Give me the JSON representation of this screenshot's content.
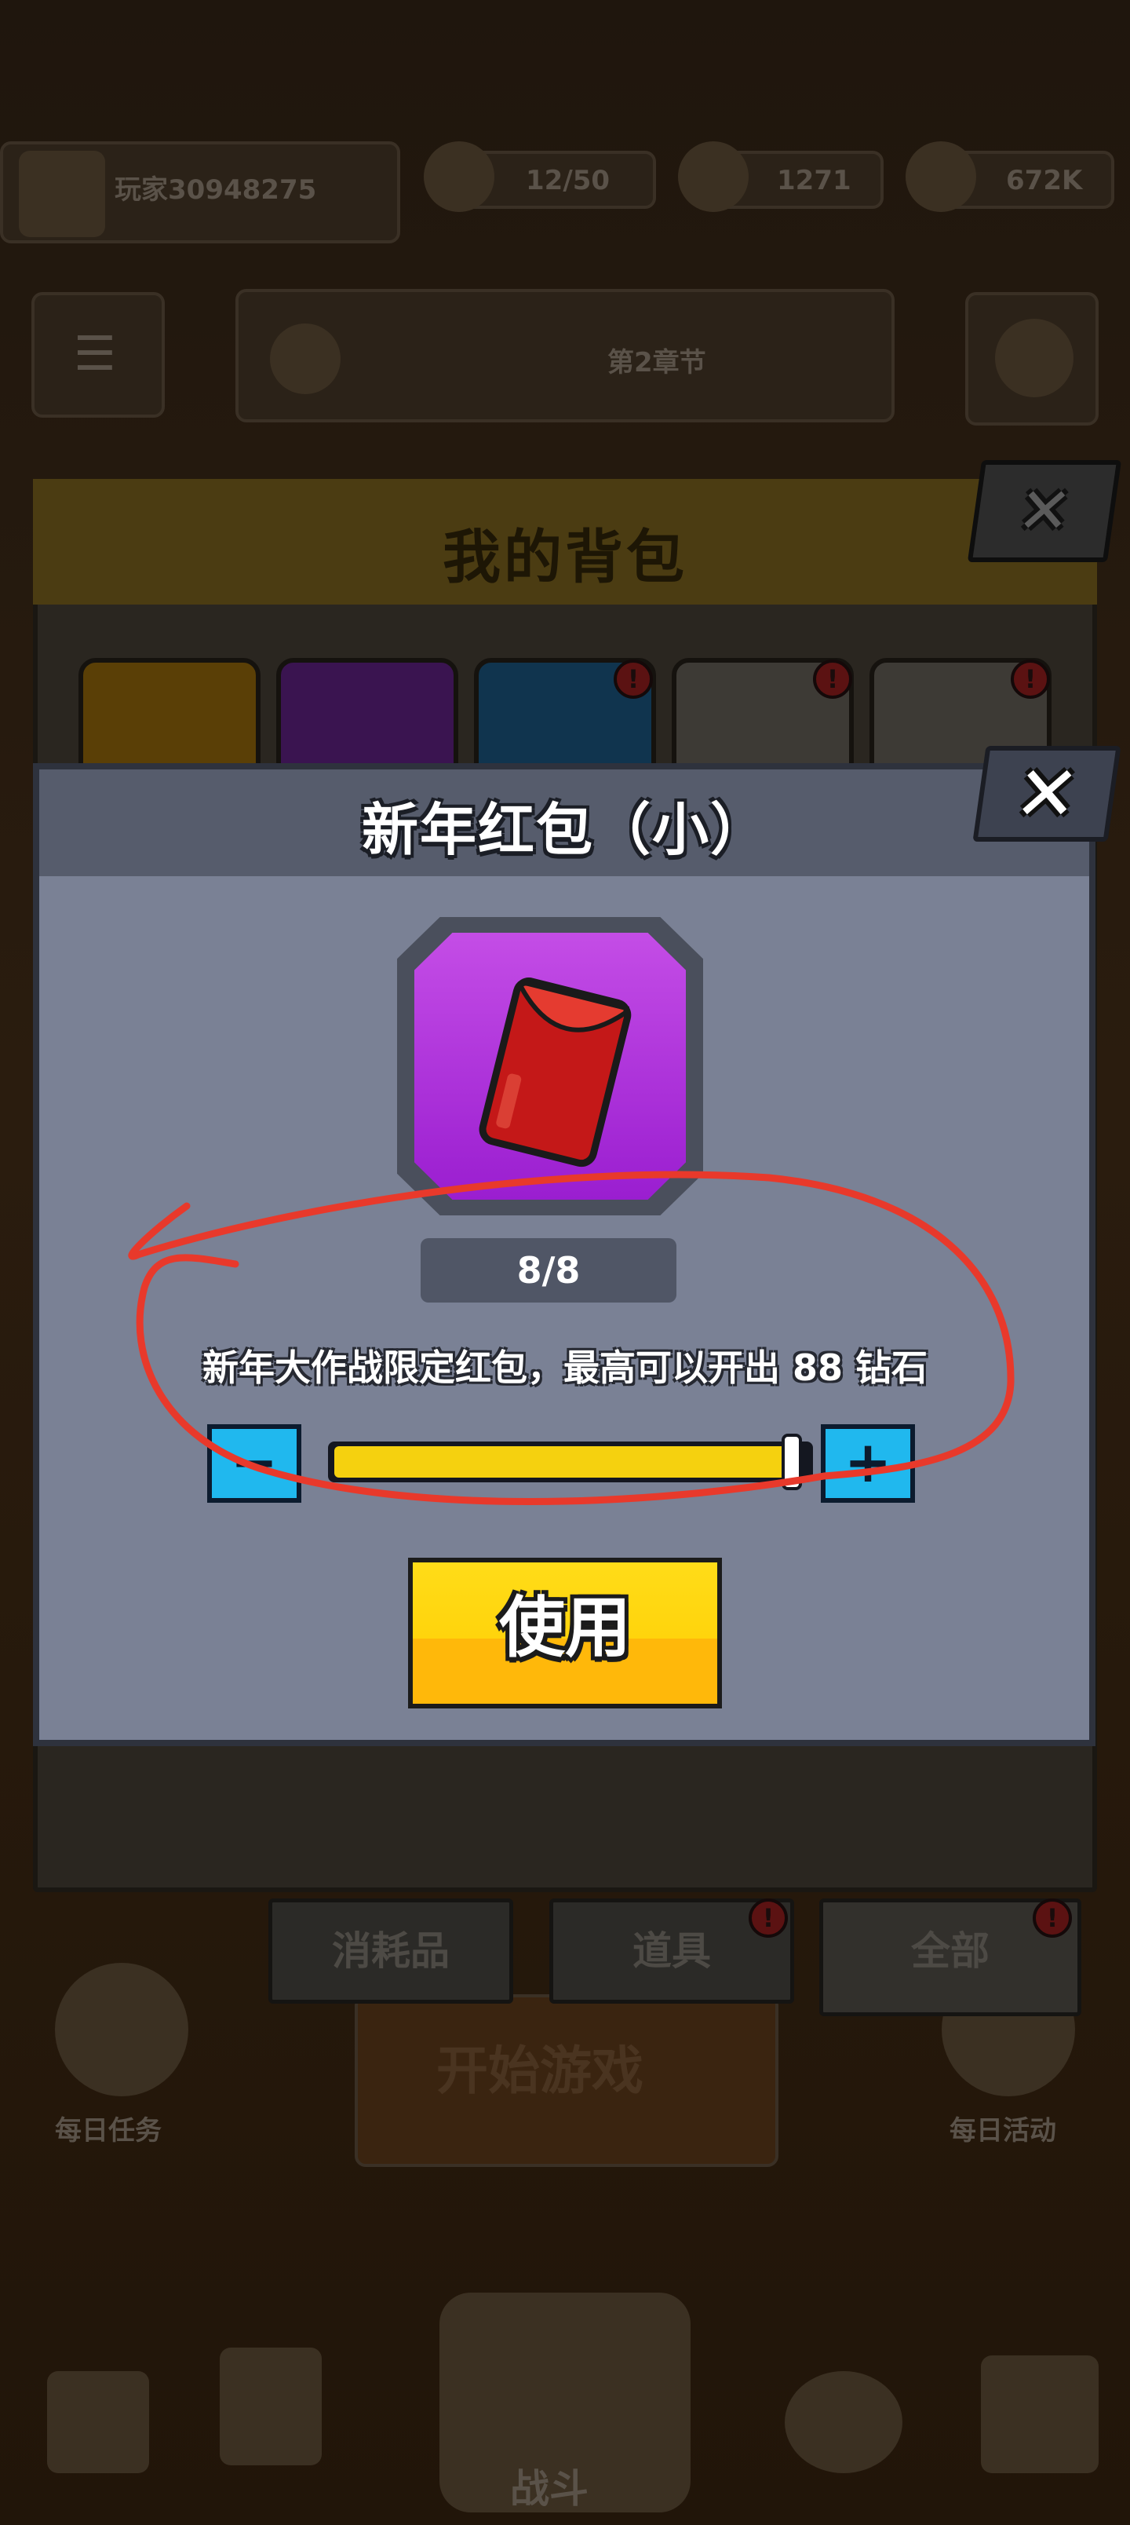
{
  "hud": {
    "player_name": "玩家30948275",
    "energy": "12/50",
    "gems": "1271",
    "coins": "672K"
  },
  "lobby": {
    "stage_info": "第2章节",
    "side_left_label": "每日任务",
    "side_right_label": "每日活动",
    "start_game": "开始游戏",
    "battle_label": "战斗"
  },
  "bag": {
    "title": "我的背包",
    "tabs": [
      {
        "label": "消耗品"
      },
      {
        "label": "道具"
      },
      {
        "label": "全部"
      }
    ],
    "badge_symbol": "!"
  },
  "dialog": {
    "title": "新年红包（小）",
    "count": "8/8",
    "description": "新年大作战限定红包，最高可以开出 88 钻石",
    "quantity_fraction": 1.0,
    "minus_symbol": "−",
    "plus_symbol": "+",
    "use_label": "使用",
    "close_symbol": "✕",
    "item_icon": "red-envelope-icon"
  },
  "colors": {
    "dialog_bg": "#7a8195",
    "header_bg": "#565c6c",
    "item_frame": "#9a1ed0",
    "slider_fill": "#f5d10f",
    "use_button": "#ffd40c",
    "annotation": "#e8392b"
  }
}
